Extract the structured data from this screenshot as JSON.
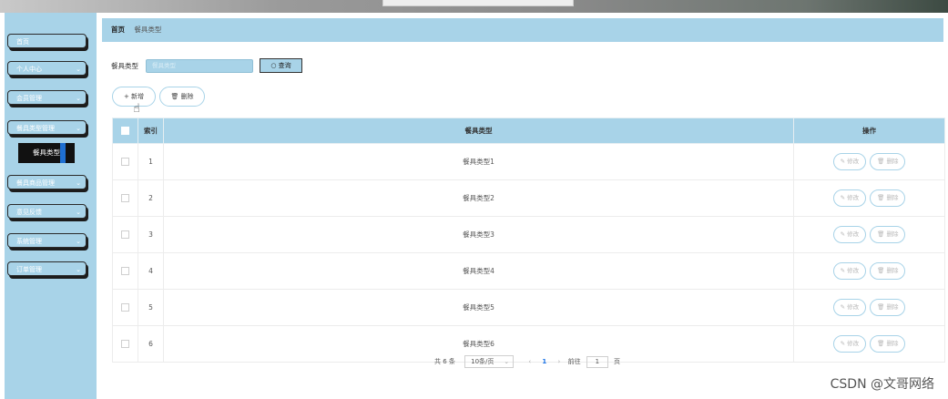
{
  "sidebar": {
    "items": [
      {
        "label": "首页",
        "chevron": ""
      },
      {
        "label": "个人中心",
        "chevron": "⌄"
      },
      {
        "label": "会员管理",
        "chevron": "⌄"
      },
      {
        "label": "餐具类型管理",
        "chevron": "⌄"
      },
      {
        "label": "餐具商品管理",
        "chevron": "⌄"
      },
      {
        "label": "意见反馈",
        "chevron": "⌄"
      },
      {
        "label": "系统管理",
        "chevron": "⌄"
      },
      {
        "label": "订单管理",
        "chevron": "⌄"
      }
    ],
    "active_sub": "餐具类型"
  },
  "breadcrumb": {
    "home": "首页",
    "current": "餐具类型"
  },
  "search": {
    "label": "餐具类型",
    "placeholder": "餐具类型",
    "button": "查询",
    "button_icon": "search-icon"
  },
  "toolbar": {
    "add_label": "新增",
    "add_icon": "+",
    "delete_label": "删除",
    "delete_icon": "trash-icon"
  },
  "table": {
    "headers": {
      "index": "索引",
      "type": "餐具类型",
      "ops": "操作"
    },
    "rows": [
      {
        "index": "1",
        "type": "餐具类型1"
      },
      {
        "index": "2",
        "type": "餐具类型2"
      },
      {
        "index": "3",
        "type": "餐具类型3"
      },
      {
        "index": "4",
        "type": "餐具类型4"
      },
      {
        "index": "5",
        "type": "餐具类型5"
      },
      {
        "index": "6",
        "type": "餐具类型6"
      }
    ],
    "edit_label": "修改",
    "delete_label": "删除"
  },
  "pager": {
    "total": "共 6 条",
    "page_size": "10条/页",
    "prev": "‹",
    "current": "1",
    "next": "›",
    "goto_label": "前往",
    "goto_value": "1",
    "page_suffix": "页"
  },
  "watermark": "CSDN @文哥网络",
  "colors": {
    "accent": "#a8d3e8",
    "active_marker": "#1f6fd1",
    "page_current": "#1a73e8"
  }
}
